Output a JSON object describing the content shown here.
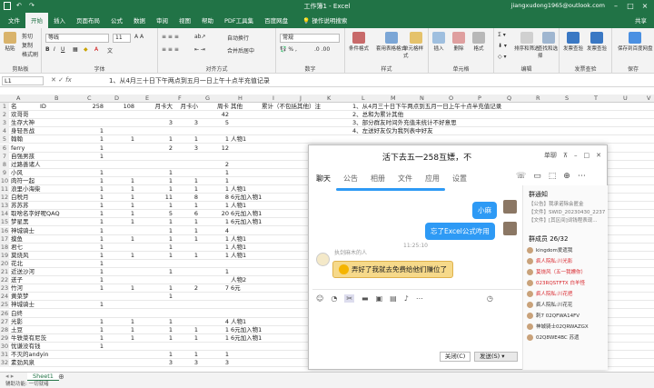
{
  "app": {
    "title": "工作簿1 - Excel",
    "user": "jiangxudong1965@outlook.com"
  },
  "ribbon": {
    "tabs": [
      "文件",
      "开始",
      "插入",
      "页面布局",
      "公式",
      "数据",
      "审阅",
      "视图",
      "帮助",
      "PDF工具集",
      "百度网盘"
    ],
    "active_tab": "开始",
    "tell_me": "操作说明搜索",
    "share": "共享",
    "font_name": "等线",
    "font_size": "11",
    "wrap_text": "自动换行",
    "merge_center": "合并后居中",
    "number_format": "常规",
    "groups": {
      "clipboard": "剪贴板",
      "font": "字体",
      "alignment": "对齐方式",
      "number": "数字",
      "styles": "样式",
      "cells": "单元格",
      "editing": "编辑",
      "invoice_check": "发票查验",
      "save": "保存"
    },
    "buttons": {
      "cut": "剪切",
      "copy": "复制",
      "paste": "粘贴",
      "format_painter": "格式刷",
      "cond_format": "条件格式",
      "table_format": "套用表格格式",
      "cell_styles": "单元格样式",
      "insert": "插入",
      "delete": "删除",
      "format": "格式",
      "sort_filter": "排序和筛选",
      "find_select": "查找和选择",
      "invoice_check": "发票查验",
      "save_baidu": "保存到百度网盘"
    }
  },
  "formula_bar": {
    "cell": "L1",
    "formula": "1、从4月三十日下午两点到五月一日上午十点半充值记录"
  },
  "columns": [
    "A",
    "B",
    "C",
    "D",
    "E",
    "F",
    "G",
    "H",
    "I",
    "J",
    "K",
    "L",
    "M",
    "N",
    "O",
    "P",
    "Q",
    "R",
    "S",
    "T",
    "U",
    "V"
  ],
  "rows": [
    {
      "n": "1",
      "a": "名",
      "b": "ID",
      "c": "258",
      "d": "108",
      "e": "月卡大",
      "f": "月卡小",
      "g": "周卡",
      "h": "其他",
      "i": "累计（不包括其他）注",
      "l": "1、从4月三十日下午两点到五月一日上午十点半充值记录"
    },
    {
      "n": "2",
      "a": "欢哥哥",
      "b": "",
      "c": "",
      "d": "",
      "e": "",
      "f": "",
      "g": "42",
      "h": "",
      "i": "",
      "l": "2、总和为累计其他"
    },
    {
      "n": "3",
      "a": "生存大神",
      "b": "",
      "c": "",
      "d": "",
      "e": "3",
      "f": "3",
      "g": "5",
      "h": "",
      "i": "",
      "l": "3、部分群友时间外充值未统计不好意思"
    },
    {
      "n": "4",
      "a": "身轻吾战",
      "b": "",
      "c": "1",
      "d": "",
      "e": "",
      "f": "",
      "g": "",
      "h": "",
      "i": "",
      "l": "4、左送好友仅为我列表中好友"
    },
    {
      "n": "5",
      "a": "翰翰",
      "b": "",
      "c": "1",
      "d": "1",
      "e": "1",
      "f": "1",
      "g": "1",
      "h": "人物1",
      "i": "",
      "l": ""
    },
    {
      "n": "6",
      "a": "ferry",
      "b": "",
      "c": "1",
      "d": "",
      "e": "2",
      "f": "3",
      "g": "12",
      "h": "",
      "i": "",
      "l": ""
    },
    {
      "n": "7",
      "a": "自强男孩",
      "b": "",
      "c": "1",
      "d": "",
      "e": "",
      "f": "",
      "g": "",
      "h": "",
      "i": "",
      "l": ""
    },
    {
      "n": "8",
      "a": "过路善诸人",
      "b": "",
      "c": "",
      "d": "",
      "e": "",
      "f": "",
      "g": "2",
      "h": "",
      "i": "",
      "l": ""
    },
    {
      "n": "9",
      "a": "小风",
      "b": "",
      "c": "1",
      "d": "",
      "e": "1",
      "f": "",
      "g": "1",
      "h": "",
      "i": "",
      "l": ""
    },
    {
      "n": "10",
      "a": "肉符一起",
      "b": "",
      "c": "1",
      "d": "1",
      "e": "1",
      "f": "1",
      "g": "1",
      "h": "",
      "i": "",
      "l": ""
    },
    {
      "n": "11",
      "a": "浪里小海柴",
      "b": "",
      "c": "1",
      "d": "1",
      "e": "1",
      "f": "1",
      "g": "1",
      "h": "人物1",
      "i": "",
      "l": ""
    },
    {
      "n": "12",
      "a": "白税月",
      "b": "",
      "c": "1",
      "d": "1",
      "e": "11",
      "f": "8",
      "g": "8",
      "h": "6元加入物1",
      "i": "",
      "l": ""
    },
    {
      "n": "13",
      "a": "苏苏苏",
      "b": "",
      "c": "1",
      "d": "1",
      "e": "1",
      "f": "1",
      "g": "1",
      "h": "人物1",
      "i": "",
      "l": ""
    },
    {
      "n": "14",
      "a": "取啥名字好呢QAQ",
      "b": "",
      "c": "1",
      "d": "1",
      "e": "5",
      "f": "6",
      "g": "20",
      "h": "6元加入物1",
      "i": "",
      "l": ""
    },
    {
      "n": "15",
      "a": "梦星黑",
      "b": "",
      "c": "1",
      "d": "1",
      "e": "1",
      "f": "1",
      "g": "1",
      "h": "6元加入物1",
      "i": "",
      "l": ""
    },
    {
      "n": "16",
      "a": "神城骑士",
      "b": "",
      "c": "1",
      "d": "",
      "e": "1",
      "f": "1",
      "g": "4",
      "h": "",
      "i": "",
      "l": ""
    },
    {
      "n": "17",
      "a": "摸鱼",
      "b": "",
      "c": "1",
      "d": "1",
      "e": "1",
      "f": "1",
      "g": "1",
      "h": "人物1",
      "i": "",
      "l": ""
    },
    {
      "n": "18",
      "a": "君七",
      "b": "",
      "c": "1",
      "d": "",
      "e": "1",
      "f": "",
      "g": "1",
      "h": "人物1",
      "i": "",
      "l": ""
    },
    {
      "n": "19",
      "a": "莫烧风",
      "b": "",
      "c": "1",
      "d": "1",
      "e": "1",
      "f": "1",
      "g": "1",
      "h": "人物1",
      "i": "",
      "l": ""
    },
    {
      "n": "20",
      "a": "花北",
      "b": "",
      "c": "1",
      "d": "",
      "e": "",
      "f": "",
      "g": "",
      "h": "",
      "i": "",
      "l": ""
    },
    {
      "n": "21",
      "a": "近送沙河",
      "b": "",
      "c": "1",
      "d": "",
      "e": "1",
      "f": "",
      "g": "1",
      "h": "",
      "i": "",
      "l": ""
    },
    {
      "n": "22",
      "a": "迸子",
      "b": "",
      "c": "1",
      "d": "",
      "e": "",
      "f": "",
      "g": "",
      "h": "人物2",
      "i": "",
      "l": ""
    },
    {
      "n": "23",
      "a": "竹河",
      "b": "",
      "c": "1",
      "d": "1",
      "e": "1",
      "f": "2",
      "g": "7",
      "h": "6元",
      "i": "",
      "l": ""
    },
    {
      "n": "24",
      "a": "黄菜梦",
      "b": "",
      "c": "",
      "d": "",
      "e": "1",
      "f": "",
      "g": "",
      "h": "",
      "i": "",
      "l": ""
    },
    {
      "n": "25",
      "a": "神城骑士",
      "b": "",
      "c": "1",
      "d": "",
      "e": "",
      "f": "",
      "g": "",
      "h": "",
      "i": "",
      "l": ""
    },
    {
      "n": "26",
      "a": "白终",
      "b": "",
      "c": "",
      "d": "",
      "e": "",
      "f": "",
      "g": "",
      "h": "",
      "i": "",
      "l": ""
    },
    {
      "n": "27",
      "a": "光影",
      "b": "",
      "c": "1",
      "d": "1",
      "e": "1",
      "f": "",
      "g": "4",
      "h": "人物1",
      "i": "",
      "l": ""
    },
    {
      "n": "28",
      "a": "土豆",
      "b": "",
      "c": "1",
      "d": "1",
      "e": "1",
      "f": "1",
      "g": "1",
      "h": "6元加入物1",
      "i": "",
      "l": ""
    },
    {
      "n": "29",
      "a": "牛轶菜有尼茨",
      "b": "",
      "c": "1",
      "d": "1",
      "e": "1",
      "f": "1",
      "g": "1",
      "h": "6元加入物1",
      "i": "",
      "l": ""
    },
    {
      "n": "30",
      "a": "忧谦没有钱",
      "b": "",
      "c": "1",
      "d": "",
      "e": "",
      "f": "",
      "g": "",
      "h": "",
      "i": "",
      "l": ""
    },
    {
      "n": "31",
      "a": "不灭的andyin",
      "b": "",
      "c": "",
      "d": "",
      "e": "1",
      "f": "1",
      "g": "1",
      "h": "",
      "i": "",
      "l": ""
    },
    {
      "n": "32",
      "a": "素劲风泉",
      "b": "",
      "c": "",
      "d": "",
      "e": "3",
      "f": "3",
      "g": "3",
      "h": "",
      "i": "",
      "l": ""
    }
  ],
  "sheet": {
    "tab": "Sheet1"
  },
  "status": {
    "text": "辅助功能: 一切就绪"
  },
  "chat": {
    "title": "活下去五一258互嫖，不",
    "tabs": [
      "聊天",
      "公告",
      "相册",
      "文件",
      "应用",
      "设置"
    ],
    "messages": {
      "me1": "小麻",
      "me2": "忘了Excel公式咋用",
      "time": "11:25:10",
      "other_name": "执剑麻木的人",
      "other": "弄好了我就去免费给他们赚位了"
    },
    "close_btn": "关闭(C)",
    "send_btn": "发送(S)",
    "side": {
      "notice_title": "群通知",
      "notice_line": "【公告】我承诺除会匿金",
      "file_line": "【文件】SWID_20230430_2237...",
      "file_line2": "【文件】[其区间]词钱程表现...",
      "members_title": "群成员 26/32",
      "members": [
        {
          "name": "kingdom爱遗我",
          "color": "gray"
        },
        {
          "name": "疯人院私:川光影",
          "color": "red"
        },
        {
          "name": "莫烧风（五一我嫖你）",
          "color": "red"
        },
        {
          "name": "023RQSTFTX 白羊怪",
          "color": "red"
        },
        {
          "name": "疯人院私:川花把",
          "color": "red"
        },
        {
          "name": "疯人院私:川花花",
          "color": "gray"
        },
        {
          "name": "刺7 02QFWA14FV",
          "color": "gray"
        },
        {
          "name": "神城骑士02QRWAZGX",
          "color": "gray"
        },
        {
          "name": "02Q8WE4BC 苏遗",
          "color": "gray"
        }
      ]
    }
  }
}
